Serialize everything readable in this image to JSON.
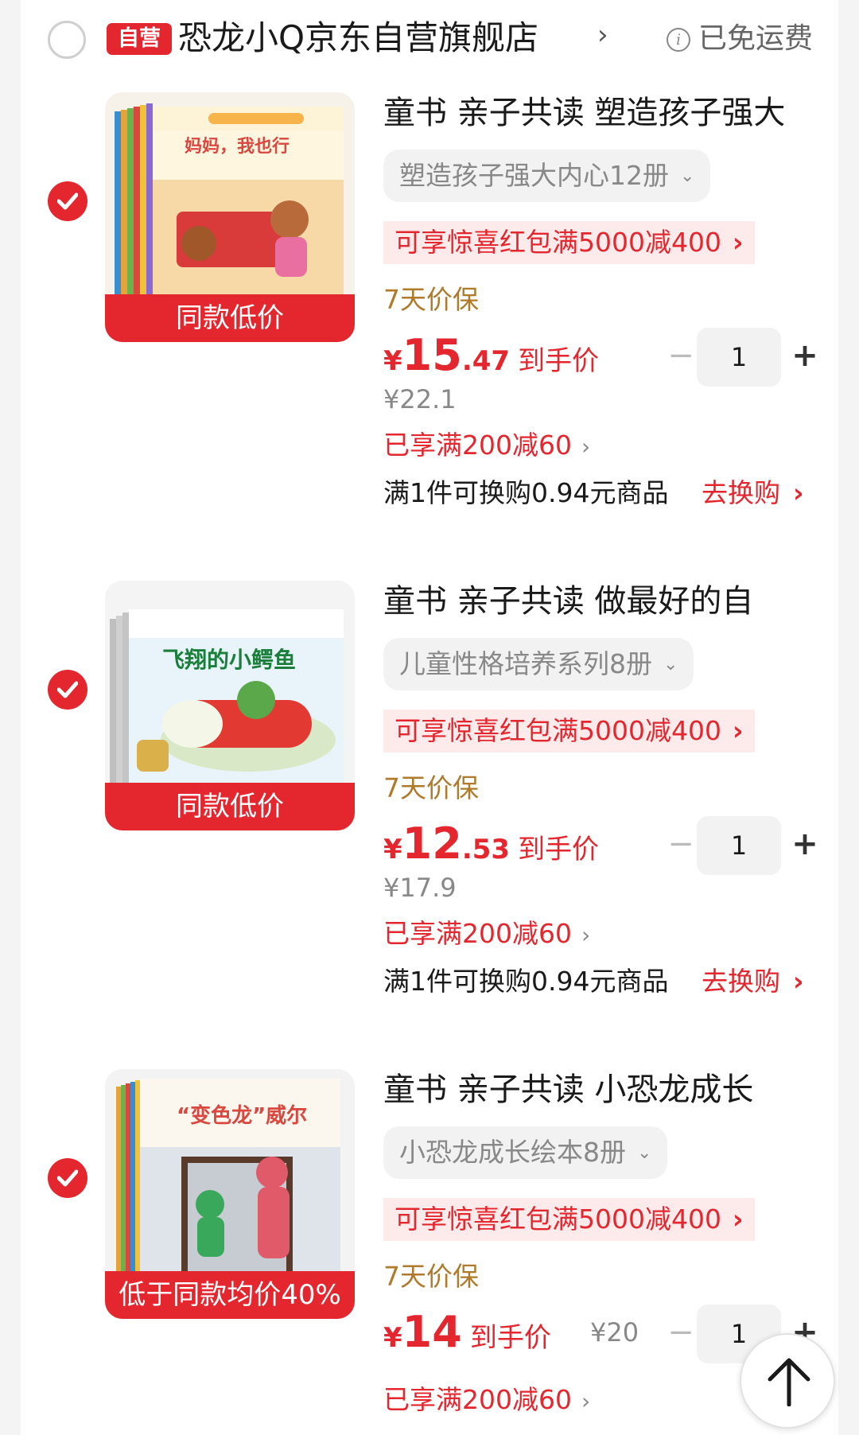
{
  "store": {
    "select_state": "unchecked",
    "badge": "自营",
    "name": "恐龙小Q京东自营旗舰店",
    "arrow": "›",
    "freight_icon": "i",
    "freight_text": "已免运费"
  },
  "colors": {
    "accent": "#e4262e",
    "coupon_bg": "#fdeaea",
    "guarantee": "#b07a2a",
    "muted": "#888888"
  },
  "items": [
    {
      "checked": true,
      "image_tag": "同款低价",
      "cover_title": "妈妈，我也行",
      "title": "童书 亲子共读 塑造孩子强大",
      "spec": "塑造孩子强大内心12册",
      "coupon": "可享惊喜红包满5000减400",
      "guarantee": "7天价保",
      "price_yen": "¥",
      "price_int": "15",
      "price_dec": ".47",
      "price_note": "到手价",
      "original_price": "¥22.1",
      "quantity": "1",
      "promo": "已享满200减60",
      "swap_text": "满1件可换购0.94元商品",
      "swap_button": "去换购"
    },
    {
      "checked": true,
      "image_tag": "同款低价",
      "cover_title": "飞翔的小鳄鱼",
      "title": "童书 亲子共读  做最好的自",
      "spec": "儿童性格培养系列8册",
      "coupon": "可享惊喜红包满5000减400",
      "guarantee": "7天价保",
      "price_yen": "¥",
      "price_int": "12",
      "price_dec": ".53",
      "price_note": "到手价",
      "original_price": "¥17.9",
      "quantity": "1",
      "promo": "已享满200减60",
      "swap_text": "满1件可换购0.94元商品",
      "swap_button": "去换购"
    },
    {
      "checked": true,
      "image_tag": "低于同款均价40%",
      "cover_title": "“变色龙”威尔",
      "title": "童书 亲子共读   小恐龙成长",
      "spec": "小恐龙成长绘本8册",
      "coupon": "可享惊喜红包满5000减400",
      "guarantee": "7天价保",
      "price_yen": "¥",
      "price_int": "14",
      "price_dec": "",
      "price_note": "到手价",
      "original_price": "¥20",
      "quantity": "1",
      "promo": "已享满200减60"
    }
  ],
  "icons": {
    "check": "checkmark-icon",
    "minus": "minus-icon",
    "plus": "plus-icon",
    "scroll_top": "arrow-up-icon"
  },
  "controls": {
    "minus": "−",
    "plus": "+",
    "chevron": "⌄",
    "arrow": "›"
  }
}
